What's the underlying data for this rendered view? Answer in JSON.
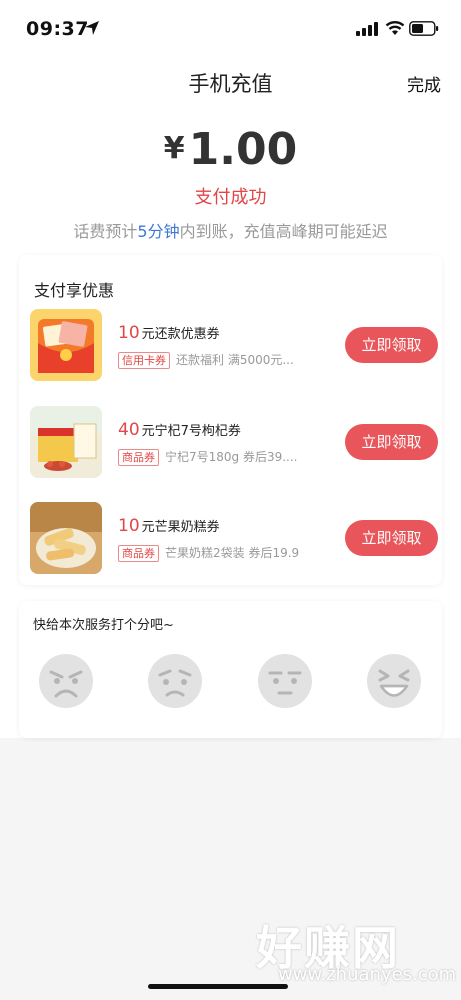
{
  "status_bar": {
    "time": "09:37"
  },
  "header": {
    "title": "手机充值",
    "done_label": "完成"
  },
  "payment": {
    "currency": "¥",
    "amount": "1.00",
    "status": "支付成功",
    "note_prefix": "话费预计",
    "note_highlight": "5分钟",
    "note_suffix": "内到账，充值高峰期可能延迟"
  },
  "coupons": {
    "title": "支付享优惠",
    "items": [
      {
        "amount": "10",
        "name": "元还款优惠券",
        "tag": "信用卡券",
        "desc": "还款福利 满5000元...",
        "button": "立即领取",
        "thumb_icon": "red-envelope-coupon-image"
      },
      {
        "amount": "40",
        "name": "元宁杞7号枸杞券",
        "tag": "商品券",
        "desc": "宁杞7号180g 券后39....",
        "button": "立即领取",
        "thumb_icon": "goji-gift-box-image"
      },
      {
        "amount": "10",
        "name": "元芒果奶糕券",
        "tag": "商品券",
        "desc": "芒果奶糕2袋装 券后19.9",
        "button": "立即领取",
        "thumb_icon": "mango-cake-image"
      }
    ]
  },
  "rating": {
    "title": "快给本次服务打个分吧~",
    "faces": [
      "angry-face-icon",
      "sad-face-icon",
      "neutral-face-icon",
      "laughing-face-icon"
    ]
  },
  "watermark": {
    "text": "好赚网",
    "url": "www.zhuanyes.com"
  },
  "colors": {
    "accent_red": "#e24646",
    "button_red": "#e8555a",
    "highlight_blue": "#3c78d8"
  }
}
